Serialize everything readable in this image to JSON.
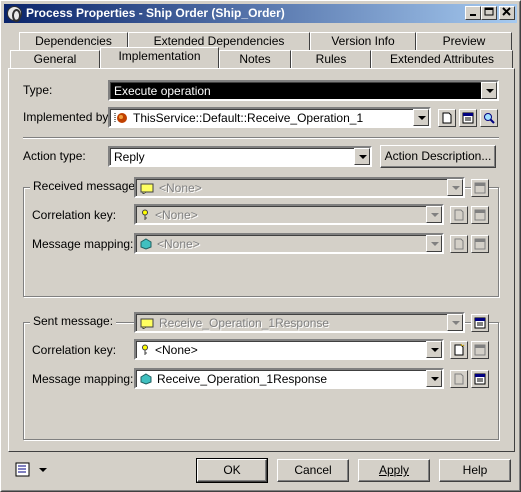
{
  "window": {
    "title": "Process Properties - Ship Order (Ship_Order)"
  },
  "tabs_back": [
    "Dependencies",
    "Extended Dependencies",
    "Version Info",
    "Preview"
  ],
  "tabs_front": [
    "General",
    "Implementation",
    "Notes",
    "Rules",
    "Extended Attributes"
  ],
  "active_tab": "Implementation",
  "form": {
    "type_label": "Type:",
    "type_value": "Execute operation",
    "implemented_label": "Implemented by:",
    "implemented_value": "ThisService::Default::Receive_Operation_1",
    "action_type_label": "Action type:",
    "action_type_value": "Reply",
    "action_description_button": "Action Description..."
  },
  "received": {
    "group_label": "Received message:",
    "message_value": "<None>",
    "correlation_label": "Correlation key:",
    "correlation_value": "<None>",
    "mapping_label": "Message mapping:",
    "mapping_value": "<None>"
  },
  "sent": {
    "group_label": "Sent message:",
    "message_value": "Receive_Operation_1Response",
    "correlation_label": "Correlation key:",
    "correlation_value": "<None>",
    "mapping_label": "Message mapping:",
    "mapping_value": "Receive_Operation_1Response"
  },
  "buttons": {
    "ok": "OK",
    "cancel": "Cancel",
    "apply": "Apply",
    "help": "Help"
  },
  "icons": [
    "properties-icon",
    "minimize-icon",
    "maximize-icon",
    "close-icon",
    "operation-icon",
    "new-icon",
    "properties-icon",
    "find-icon",
    "message-icon",
    "key-icon",
    "mapping-icon",
    "menu-icon"
  ]
}
